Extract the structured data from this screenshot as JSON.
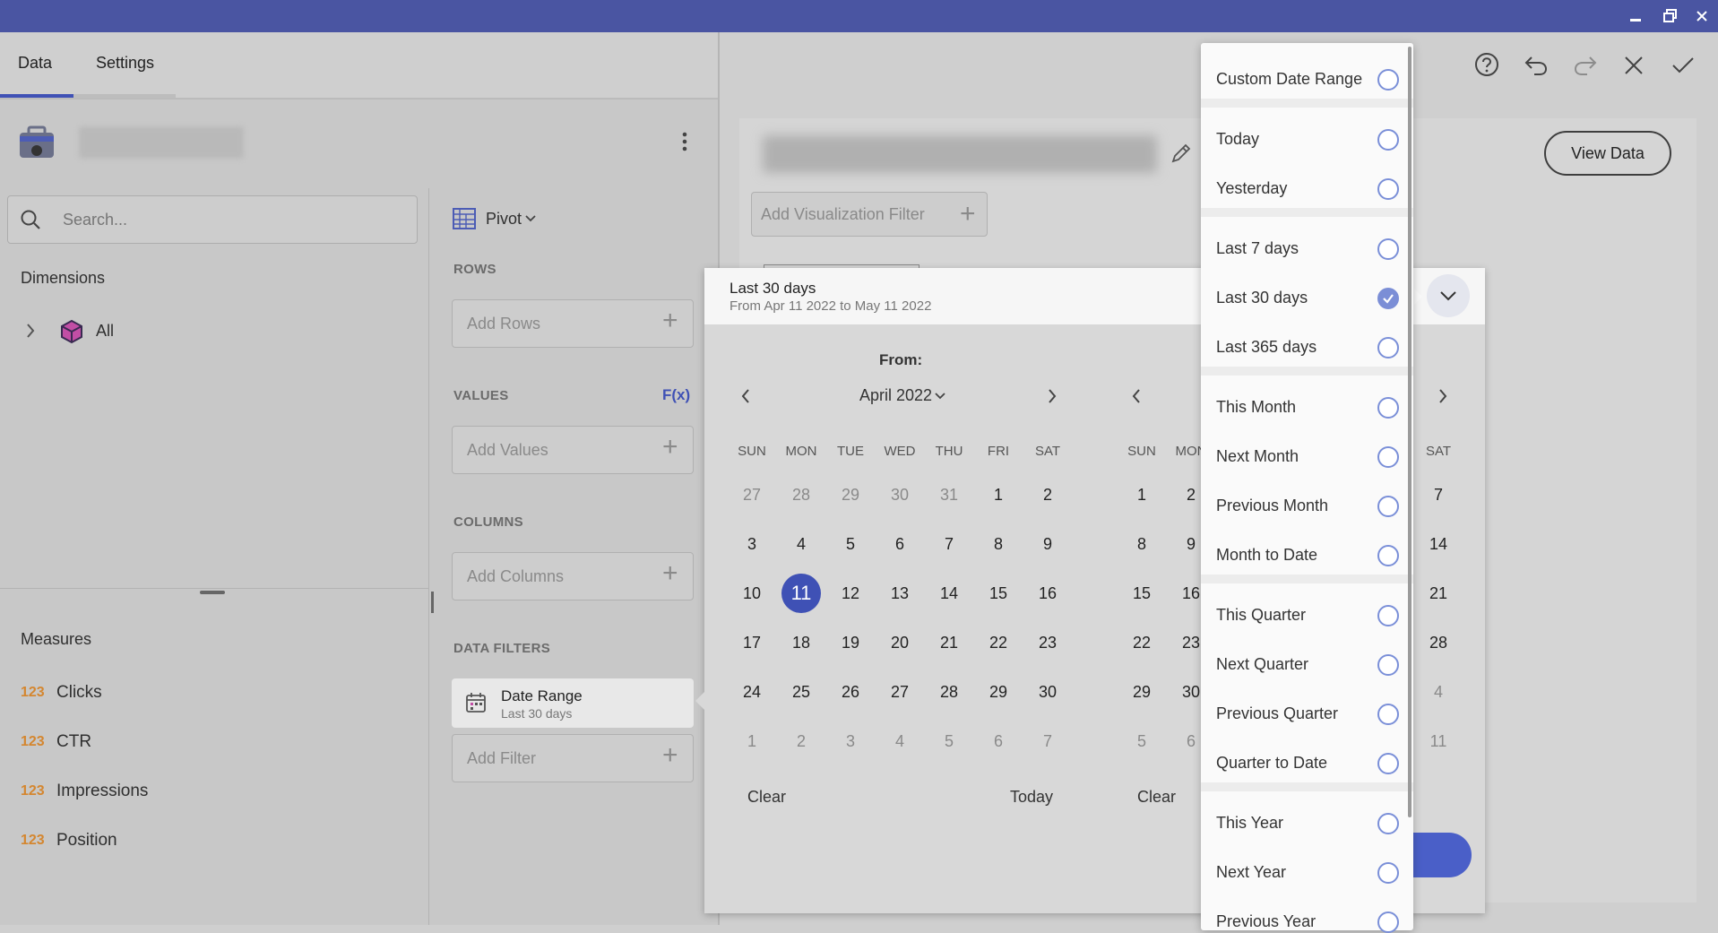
{
  "window": {
    "controls": [
      "minimize-icon",
      "restore-icon",
      "close-icon"
    ]
  },
  "tabs": [
    {
      "label": "Data",
      "active": true
    },
    {
      "label": "Settings",
      "active": false
    }
  ],
  "toolbar": {
    "icons": [
      "help-icon",
      "undo-icon",
      "redo-icon",
      "close-icon",
      "check-icon"
    ]
  },
  "search": {
    "placeholder": "Search..."
  },
  "dimensions": {
    "title": "Dimensions",
    "items": [
      {
        "label": "All"
      }
    ]
  },
  "measures": {
    "title": "Measures",
    "items": [
      {
        "type": "123",
        "label": "Clicks"
      },
      {
        "type": "123",
        "label": "CTR"
      },
      {
        "type": "123",
        "label": "Impressions"
      },
      {
        "type": "123",
        "label": "Position"
      }
    ]
  },
  "pivot": {
    "mode_label": "Pivot",
    "rows_label": "ROWS",
    "add_rows": "Add Rows",
    "values_label": "VALUES",
    "fx_label": "F(x)",
    "add_values": "Add Values",
    "columns_label": "COLUMNS",
    "add_columns": "Add Columns",
    "filters_label": "DATA FILTERS",
    "filter": {
      "title": "Date Range",
      "subtitle": "Last 30 days"
    },
    "add_filter": "Add Filter"
  },
  "viz": {
    "add_filter": "Add Visualization Filter",
    "view_data": "View Data"
  },
  "date_dialog": {
    "selected_label": "Last 30 days",
    "range_text": "From Apr 11 2022 to May 11 2022",
    "from_label": "From:",
    "left_month": "April 2022",
    "weekdays": [
      "SUN",
      "MON",
      "TUE",
      "WED",
      "THU",
      "FRI",
      "SAT"
    ],
    "left_weeks": [
      [
        "27",
        "28",
        "29",
        "30",
        "31",
        "1",
        "2"
      ],
      [
        "3",
        "4",
        "5",
        "6",
        "7",
        "8",
        "9"
      ],
      [
        "10",
        "11",
        "12",
        "13",
        "14",
        "15",
        "16"
      ],
      [
        "17",
        "18",
        "19",
        "20",
        "21",
        "22",
        "23"
      ],
      [
        "24",
        "25",
        "26",
        "27",
        "28",
        "29",
        "30"
      ],
      [
        "1",
        "2",
        "3",
        "4",
        "5",
        "6",
        "7"
      ]
    ],
    "selected_day": "11",
    "right_visible_weekdays": [
      "SUN",
      "MON",
      "SAT"
    ],
    "right_col_sun": [
      "1",
      "8",
      "15",
      "22",
      "29",
      "5"
    ],
    "right_col_mon": [
      "2",
      "9",
      "16",
      "23",
      "30",
      "6"
    ],
    "right_col_sat": [
      "7",
      "14",
      "21",
      "28",
      "4",
      "11"
    ],
    "clear": "Clear",
    "today": "Today"
  },
  "presets": {
    "selected": "Last 30 days",
    "groups": [
      [
        "Custom Date Range"
      ],
      [
        "Today",
        "Yesterday"
      ],
      [
        "Last 7 days",
        "Last 30 days",
        "Last 365 days"
      ],
      [
        "This Month",
        "Next Month",
        "Previous Month",
        "Month to Date"
      ],
      [
        "This Quarter",
        "Next Quarter",
        "Previous Quarter",
        "Quarter to Date"
      ],
      [
        "This Year",
        "Next Year",
        "Previous Year"
      ]
    ]
  },
  "colors": {
    "accent": "#3f51b5",
    "titlebar": "#4a55a2",
    "measure_badge": "#d4862f",
    "radio": "#7a8fd8"
  }
}
